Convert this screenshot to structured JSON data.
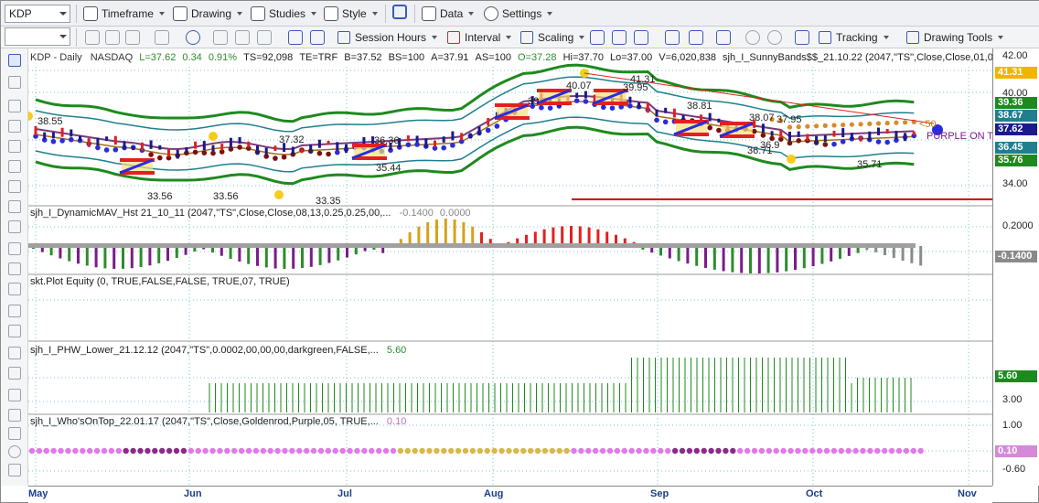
{
  "toolbar": {
    "symbol": "KDP",
    "timeframe": "Timeframe",
    "drawing": "Drawing",
    "studies": "Studies",
    "style": "Style",
    "data": "Data",
    "settings": "Settings",
    "session_hours": "Session Hours",
    "interval": "Interval",
    "scaling": "Scaling",
    "tracking": "Tracking",
    "drawing_tools": "Drawing Tools"
  },
  "header": {
    "symbol": "KDP - Daily",
    "exchange": "NASDAQ",
    "last": "L=37.62",
    "change": "0.34",
    "pct": "0.91%",
    "ts": "TS=92,098",
    "te": "TE=TRF",
    "bid": "B=37.52",
    "bs": "BS=100",
    "ask": "A=37.91",
    "as": "AS=100",
    "open": "O=37.28",
    "hi": "Hi=37.70",
    "lo": "Lo=37.00",
    "vol": "V=6,020,838",
    "study": "sjh_I_SunnyBands$$_21.10.22 (2047,\"TS\",Close,Close,01,08..."
  },
  "price_labels": {
    "a": "38.55",
    "b": "33.56",
    "c": "33.56",
    "d": "37.32",
    "e": "33.35",
    "f": "36.36",
    "g": "35.44",
    "h": "40.07",
    "i": "41.31",
    "j": "39.95",
    "k": "38.81",
    "l": "38.07",
    "m": "36.71",
    "n": "35.71",
    "o": "38.95",
    "p": "37.95",
    "q": "36.9",
    "r": "39",
    "s": "<50",
    "t": "PURPLE ON T"
  },
  "panes": {
    "p1": "sjh_I_DynamicMAV_Hst 21_10_11 (2047,\"TS\",Close,Close,08,13,0.25,0.25,00,...",
    "p1v": "-0.1400",
    "p1v2": "0.0000",
    "p2": "skt.Plot Equity (0, TRUE,FALSE,FALSE, TRUE,07, TRUE)",
    "p3": "sjh_I_PHW_Lower_21.12.12 (2047,\"TS\",0.0002,00,00,00,darkgreen,FALSE,...",
    "p3v": "5.60",
    "p4": "sjh_I_Who'sOnTop_22.01.17 (2047,\"TS\",Close,Goldenrod,Purple,05, TRUE,...",
    "p4v": "0.10"
  },
  "price_axis": {
    "t42": "42.00",
    "t40": "40.00",
    "t34": "34.00",
    "b4131": "41.31",
    "b3936": "39.36",
    "b3867": "38.67",
    "b3762": "37.62",
    "b3645": "36.45",
    "b3576": "35.76"
  },
  "osc_axis": {
    "t02": "0.2000",
    "bneg": "-0.1400"
  },
  "phw_axis": {
    "b560": "5.60",
    "t300": "3.00"
  },
  "who_axis": {
    "t100": "1.00",
    "b010": "0.10",
    "tneg": "-0.60"
  },
  "xaxis": [
    "May",
    "Jun",
    "Jul",
    "Aug",
    "Sep",
    "Oct",
    "Nov"
  ],
  "colors": {
    "up": "#1a1a8c",
    "bandGreen": "#1e8a1e",
    "bandTeal": "#1f7f8f",
    "red": "#e32020",
    "gold": "#d6a21a",
    "purple": "#7a1c8a"
  }
}
